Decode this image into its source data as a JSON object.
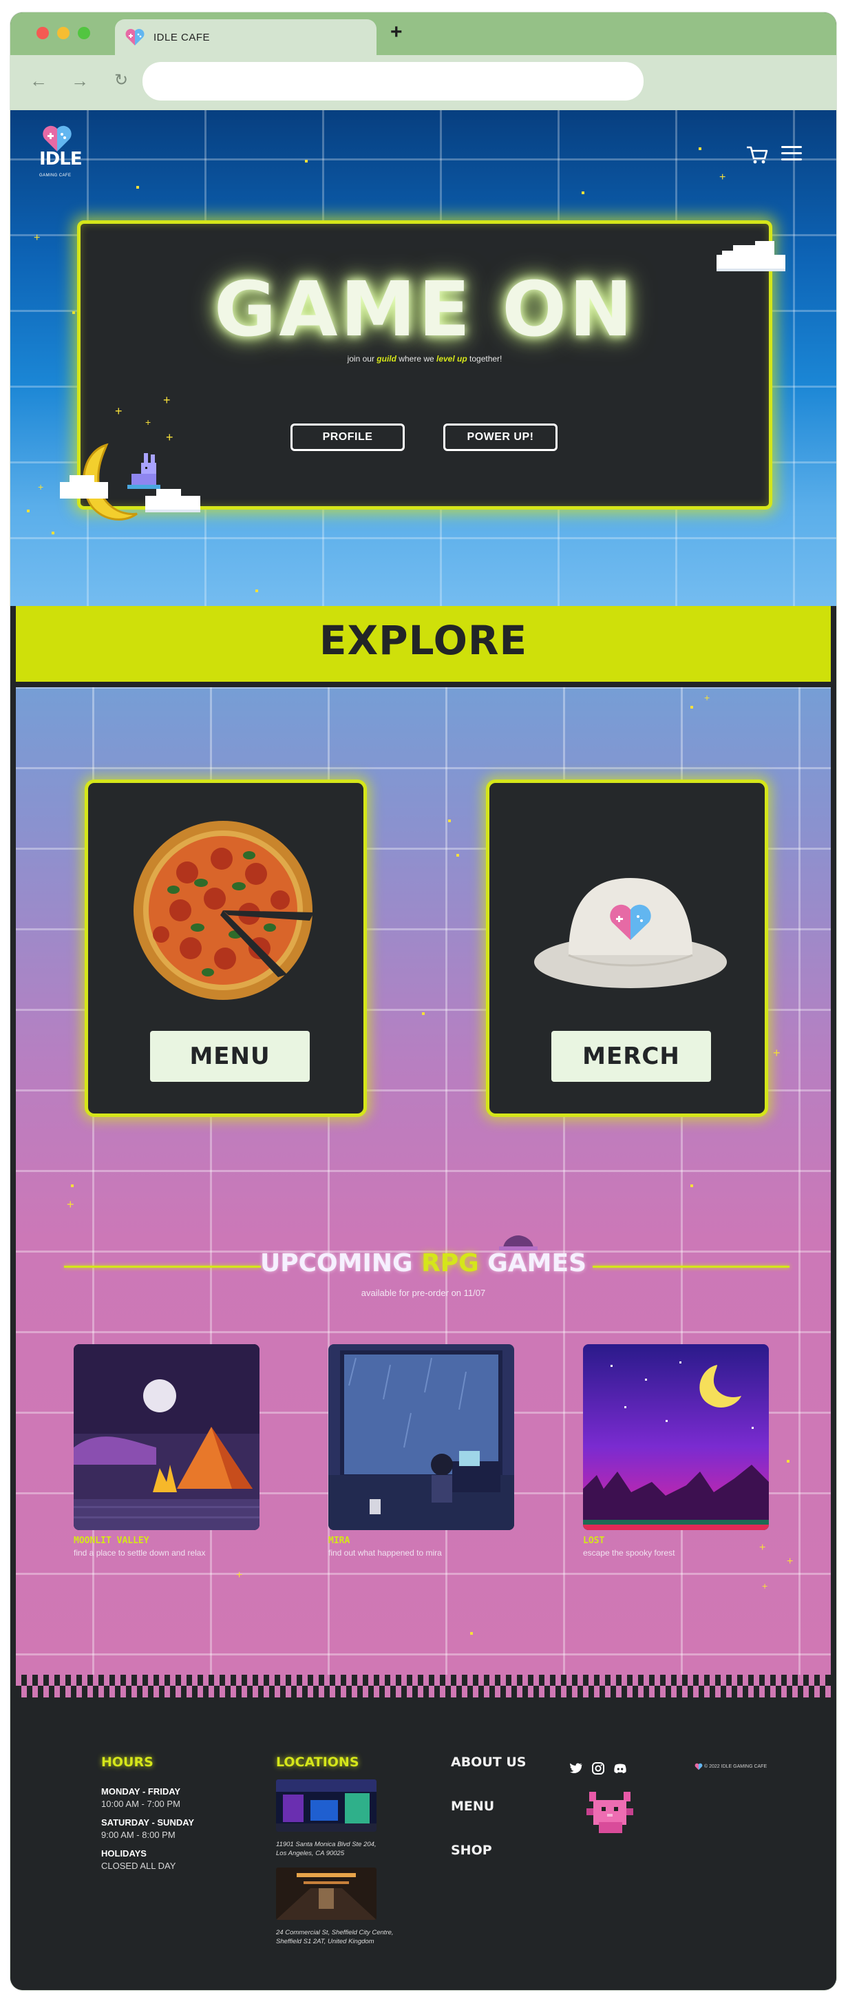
{
  "browser": {
    "tab_title": "IDLE CAFE",
    "new_tab": "+",
    "address": ""
  },
  "header": {
    "logo_text": "IDLE",
    "logo_sub": "GAMING CAFE",
    "icons": [
      "cart-icon",
      "hamburger-menu-icon"
    ]
  },
  "hero": {
    "title": "GAME ON",
    "sub_pre": "join our ",
    "sub_guild": "guild",
    "sub_mid": " where we ",
    "sub_level": "level up",
    "sub_post": " together!",
    "btn_profile": "PROFILE",
    "btn_power": "POWER UP!"
  },
  "explore": {
    "title": "EXPLORE",
    "menu_label": "MENU",
    "merch_label": "MERCH"
  },
  "upcoming": {
    "title_pre": "UPCOMING ",
    "title_rpg": "RPG",
    "title_post": " GAMES",
    "subtitle": "available for pre-order on 11/07",
    "games": [
      {
        "name": "MOONLIT VALLEY",
        "desc": "find a place to settle down and relax"
      },
      {
        "name": "MIRA",
        "desc": "find out what happened to mira"
      },
      {
        "name": "LOST",
        "desc": "escape the spooky forest"
      }
    ]
  },
  "footer": {
    "hours_title": "HOURS",
    "hours": [
      {
        "day": "MONDAY - FRIDAY",
        "time": "10:00 AM - 7:00 PM"
      },
      {
        "day": "SATURDAY - SUNDAY",
        "time": "9:00 AM - 8:00 PM"
      },
      {
        "day": "HOLIDAYS",
        "time": "CLOSED ALL DAY"
      }
    ],
    "locations_title": "LOCATIONS",
    "locations": [
      {
        "addr1": "11901 Santa Monica Blvd Ste 204,",
        "addr2": "Los Angeles, CA 90025"
      },
      {
        "addr1": "24 Commercial St, Sheffield City Centre,",
        "addr2": "Sheffield S1 2AT, United Kingdom"
      }
    ],
    "links": [
      "ABOUT US",
      "MENU",
      "SHOP"
    ],
    "social_icons": [
      "twitter-icon",
      "instagram-icon",
      "discord-icon"
    ],
    "copyright": "© 2022 IDLE GAMING CAFE"
  },
  "colors": {
    "accent": "#d5e61a",
    "dark": "#222527",
    "chrome_green": "#95c187",
    "chrome_light": "#d4e4d0",
    "pink": "#d078b4"
  }
}
